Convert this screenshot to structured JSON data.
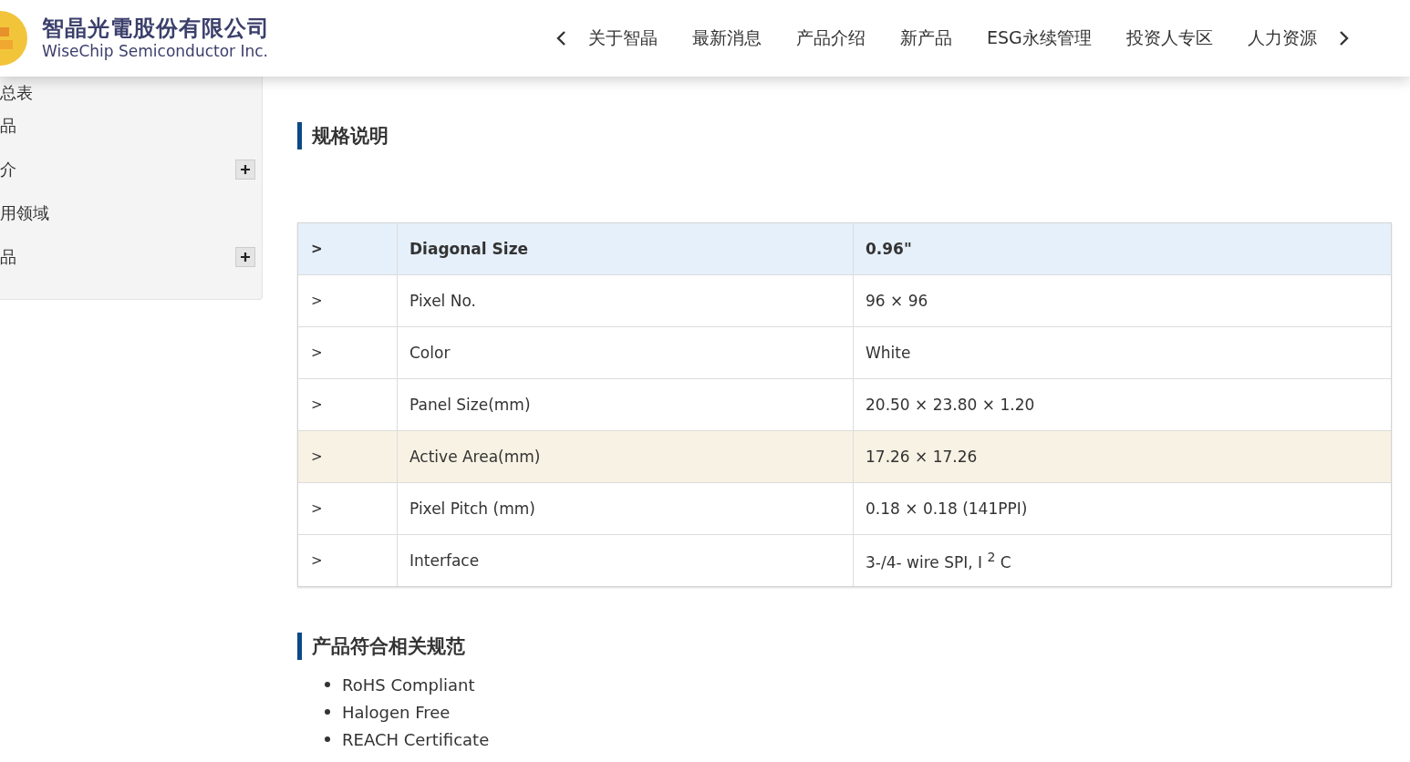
{
  "header": {
    "logo": {
      "name_zh": "智晶光電股份有限公司",
      "name_en": "WiseChip Semiconductor Inc."
    },
    "nav": [
      {
        "label": "关于智晶"
      },
      {
        "label": "最新消息"
      },
      {
        "label": "产品介绍"
      },
      {
        "label": "新产品"
      },
      {
        "label": "ESG永续管理"
      },
      {
        "label": "投资人专区"
      },
      {
        "label": "人力资源"
      }
    ]
  },
  "sidebar": {
    "items": [
      {
        "label": "总表",
        "expandable": false
      },
      {
        "label": "品",
        "expandable": false
      },
      {
        "label": "介",
        "expandable": true
      },
      {
        "label": "用领域",
        "expandable": false
      },
      {
        "label": "品",
        "expandable": true
      }
    ]
  },
  "spec_section": {
    "title": "规格说明",
    "rows": [
      {
        "arrow": ">",
        "name": "Diagonal Size",
        "value": "0.96\"",
        "selected": true,
        "hovered": false
      },
      {
        "arrow": ">",
        "name": "Pixel No.",
        "value": "96 × 96",
        "selected": false,
        "hovered": false
      },
      {
        "arrow": ">",
        "name": "Color",
        "value": "White",
        "selected": false,
        "hovered": false
      },
      {
        "arrow": ">",
        "name": "Panel Size(mm)",
        "value": "20.50 × 23.80 × 1.20",
        "selected": false,
        "hovered": false
      },
      {
        "arrow": ">",
        "name": "Active Area(mm)",
        "value": "17.26 × 17.26",
        "selected": false,
        "hovered": true
      },
      {
        "arrow": ">",
        "name": "Pixel Pitch (mm)",
        "value": "0.18 × 0.18 (141PPI)",
        "selected": false,
        "hovered": false
      },
      {
        "arrow": ">",
        "name": "Interface",
        "value": "3-/4- wire SPI, I $^{2}$ C",
        "selected": false,
        "hovered": false
      }
    ]
  },
  "compliance_section": {
    "title": "产品符合相关规范",
    "items": [
      "RoHS Compliant",
      "Halogen Free",
      "REACH Certificate"
    ]
  }
}
